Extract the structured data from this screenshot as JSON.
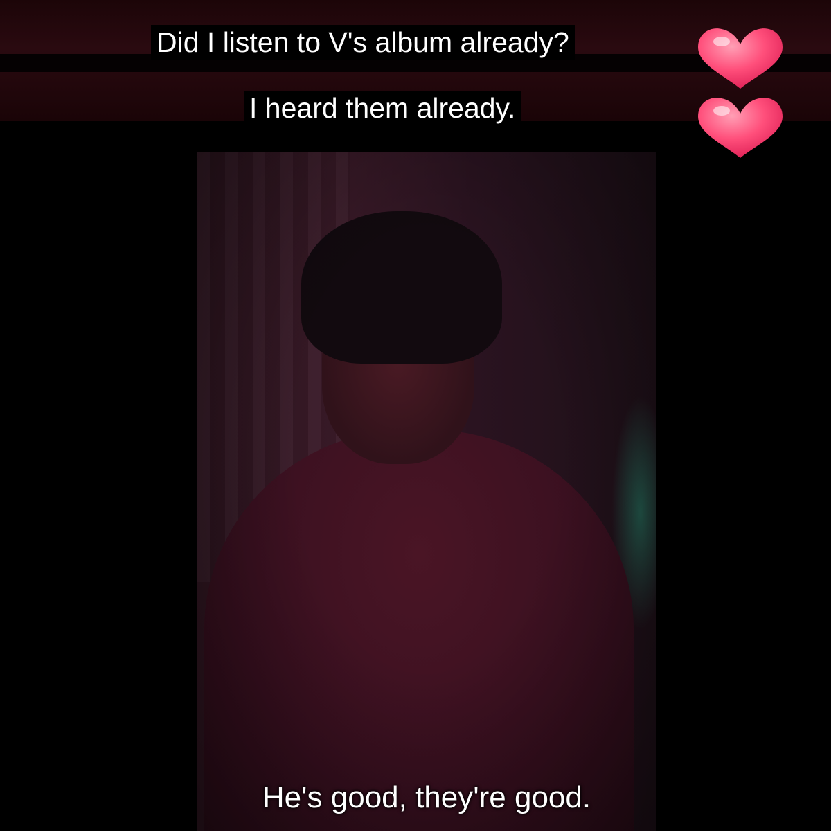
{
  "captions": {
    "line1": "Did I listen to V's album already?",
    "line2": "I heard them already."
  },
  "video": {
    "subtitle": "He's good, they're good."
  },
  "decor": {
    "heart_icon": "heart-icon",
    "heart_color": "#ff4f7b"
  }
}
